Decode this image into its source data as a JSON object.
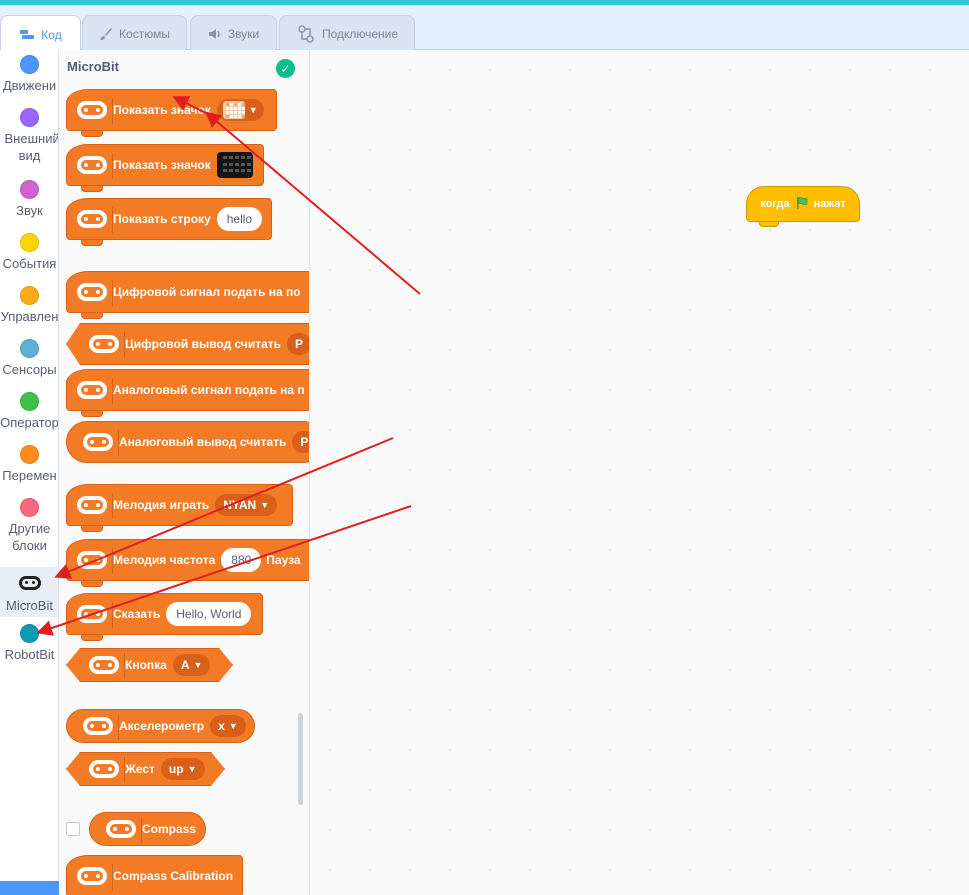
{
  "tabs": [
    {
      "label": "Код",
      "icon": "code-icon",
      "active": true
    },
    {
      "label": "Костюмы",
      "icon": "brush-icon",
      "active": false
    },
    {
      "label": "Звуки",
      "icon": "speaker-icon",
      "active": false
    },
    {
      "label": "Подключение",
      "icon": "connection-icon",
      "active": false
    }
  ],
  "categories": [
    {
      "label": "Движени",
      "color": "#4c97ff"
    },
    {
      "label": "Внешний вид",
      "color": "#9966ff"
    },
    {
      "label": "Звук",
      "color": "#cf63cf"
    },
    {
      "label": "События",
      "color": "#ffd500"
    },
    {
      "label": "Управлен",
      "color": "#ffab19"
    },
    {
      "label": "Сенсоры",
      "color": "#5cb1d6"
    },
    {
      "label": "Оператор",
      "color": "#40bf4a"
    },
    {
      "label": "Перемен",
      "color": "#ff8c1a"
    },
    {
      "label": "Другие блоки",
      "color": "#ff6680"
    },
    {
      "label": "MicroBit",
      "icon": "microbit-icon",
      "selected": true
    },
    {
      "label": "RobotBit",
      "color": "#0e9ab5"
    }
  ],
  "palette": {
    "title": "MicroBit",
    "status_icon": "check-circle-icon",
    "status_color": "#0fbd8c",
    "block_color": "#f47b25",
    "blocks": [
      {
        "text": "Показать значок",
        "input_type": "matrix-dropdown"
      },
      {
        "text": "Показать значок",
        "input_type": "matrix-image"
      },
      {
        "text": "Показать строку",
        "input": "hello"
      },
      {
        "text": "Цифровой сигнал подать на по"
      },
      {
        "text": "Цифровой вывод считать",
        "input": "P"
      },
      {
        "text": "Аналоговый сигнал подать на п"
      },
      {
        "text": "Аналоговый вывод считать",
        "input": "P"
      },
      {
        "text": "Мелодия играть",
        "dropdown": "NYAN"
      },
      {
        "text": "Мелодия частота",
        "input": "880",
        "suffix": "Пауза"
      },
      {
        "text": "Сказать",
        "input": "Hello, World"
      },
      {
        "text": "Кнопка",
        "dropdown": "A"
      },
      {
        "text": "Акселерометр",
        "dropdown": "x"
      },
      {
        "text": "Жест",
        "dropdown": "up"
      },
      {
        "text": "Compass"
      },
      {
        "text": "Compass Calibration"
      }
    ]
  },
  "workspace": {
    "event_block": {
      "prefix": "когда",
      "icon": "green-flag-icon",
      "suffix": "нажат",
      "color": "#ffbf00"
    }
  },
  "annotations": {
    "arrow_color": "#e02020"
  }
}
